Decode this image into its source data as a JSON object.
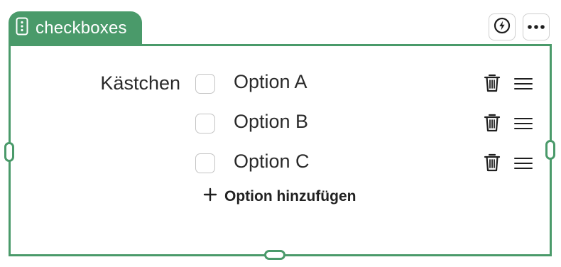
{
  "block": {
    "type_label": "checkboxes",
    "type_icon": "vertical-dots-icon",
    "actions": [
      {
        "name": "lightning-icon"
      },
      {
        "name": "more-options-icon"
      }
    ]
  },
  "field": {
    "label": "Kästchen",
    "options": [
      {
        "label": "Option A",
        "checked": false
      },
      {
        "label": "Option B",
        "checked": false
      },
      {
        "label": "Option C",
        "checked": false
      }
    ],
    "add_option_label": "Option hinzufügen"
  },
  "colors": {
    "accent": "#4a9a6a",
    "checkbox_border": "#c4c4c4"
  }
}
